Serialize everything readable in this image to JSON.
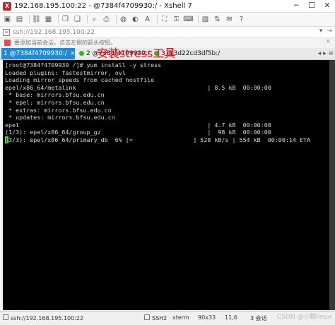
{
  "window": {
    "title": "192.168.195.100:22 - @7384f4709930:/ - Xshell 7"
  },
  "address": {
    "value": "ssh://192.168.195.100:22"
  },
  "hint": {
    "text": "要添加当前会话，点击左侧的箭头按钮。"
  },
  "tabs": [
    {
      "label": "1 @7384f4709930:/",
      "close": "×"
    },
    {
      "label": "2 @7384f4709930:/",
      "close": ""
    },
    {
      "label": "3 @3d22cd3df5b:/",
      "close": ""
    }
  ],
  "overlay": {
    "label": "安装stress工具"
  },
  "terminal": {
    "lines": [
      "[root@7384f4709930 /]# yum install -y stress",
      "Loaded plugins: fastestmirror, ovl",
      "Loading mirror speeds from cached hostfile",
      "epel/x86_64/metalink                                     | 8.5 kB  00:00:00",
      " * base: mirrors.bfsu.edu.cn",
      " * epel: mirrors.bfsu.edu.cn",
      " * extras: mirrors.bfsu.edu.cn",
      " * updates: mirrors.bfsu.edu.cn",
      "epel                                                     | 4.7 kB  00:00:00",
      "(1/3): epel/x86_64/group_gz                              |  98 kB  00:00:00"
    ],
    "progress_marker": "(",
    "progress_line": "3/3): epel/x86_64/primary_db  6% [=                 ] 528 kB/s | 554 kB  00:00:14 ETA"
  },
  "status": {
    "connection": "ssh://192.168.195.100:22",
    "protocol": "SSH2",
    "terminal_type": "xterm",
    "size": "90x33",
    "position": "11,6",
    "sessions": "3 会话"
  },
  "watermark": "CSDN @小鹏linux"
}
